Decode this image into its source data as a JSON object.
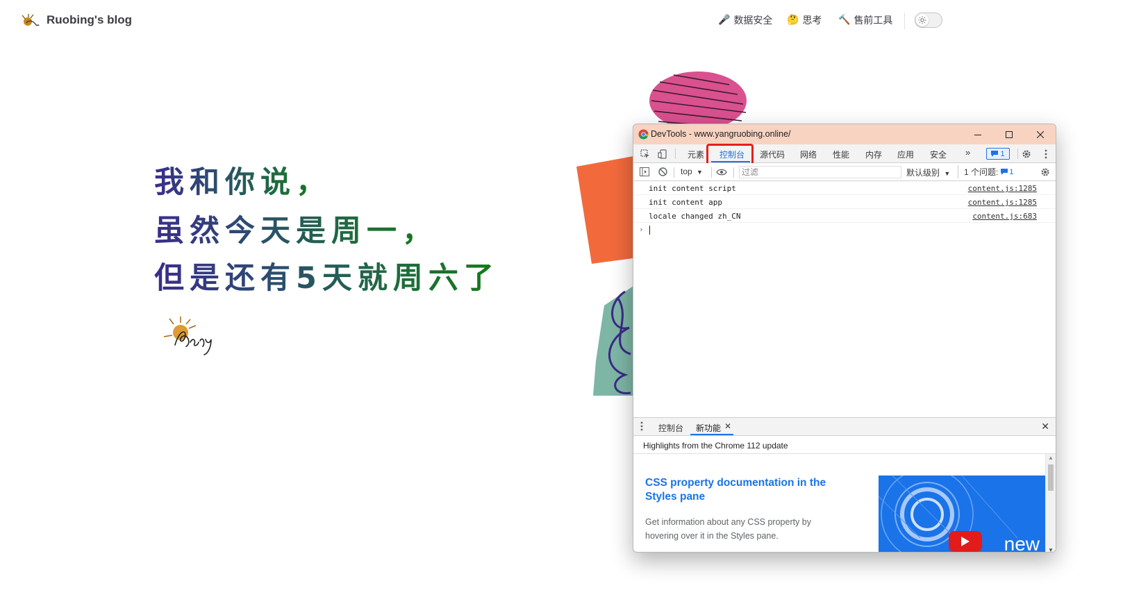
{
  "site": {
    "title": "Ruobing's blog",
    "nav": [
      {
        "emoji": "🎤",
        "label": "数据安全"
      },
      {
        "emoji": "🤔",
        "label": "思考"
      },
      {
        "emoji": "🔨",
        "label": "售前工具"
      }
    ],
    "theme_icon": "sun-icon"
  },
  "hero": {
    "lines": [
      "我和你说，",
      "虽然今天是周一，",
      "但是还有5天就周六了"
    ],
    "signature": "Roby"
  },
  "devtools": {
    "title": "DevTools - www.yangruobing.online/",
    "tabs": [
      "元素",
      "控制台",
      "源代码",
      "网络",
      "性能",
      "内存",
      "应用",
      "安全"
    ],
    "more_tabs": "»",
    "active_tab": "控制台",
    "issue_count": "1",
    "context": "top",
    "filter_placeholder": "过滤",
    "levels": "默认级别",
    "issues_label": "1 个问题:",
    "messages": [
      {
        "text": "init content script",
        "source": "content.js:1285"
      },
      {
        "text": "init content app",
        "source": "content.js:1285"
      },
      {
        "text": "locale changed zh_CN",
        "source": "content.js:683"
      }
    ],
    "prompt": "›",
    "drawer": {
      "tabs": [
        "控制台",
        "新功能"
      ],
      "active_tab": "新功能",
      "header": "Highlights from the Chrome 112 update",
      "feature_title": "CSS property documentation in the Styles pane",
      "feature_desc": "Get information about any CSS property by hovering over it in the Styles pane.",
      "thumb_label": "new"
    },
    "colors": {
      "titlebar": "#f8d3c1",
      "accent": "#1a73e8",
      "highlight_box": "#e4201c"
    }
  }
}
